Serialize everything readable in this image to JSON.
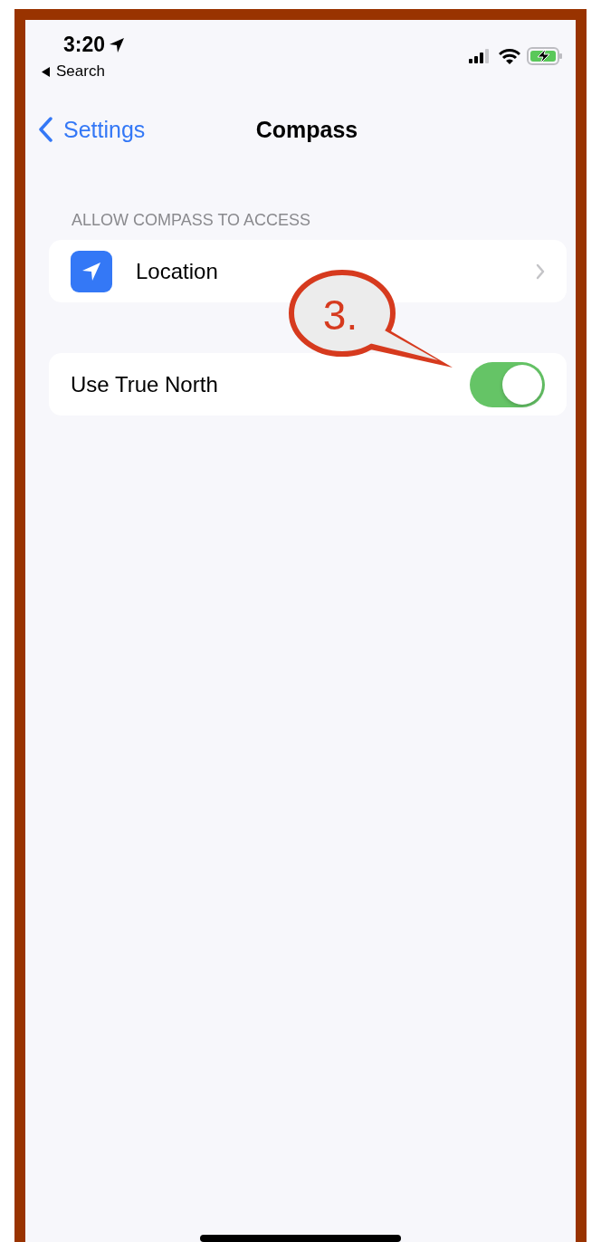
{
  "status_bar": {
    "time": "3:20",
    "back_label": "Search"
  },
  "nav": {
    "back": "Settings",
    "title": "Compass"
  },
  "sections": [
    {
      "header": "ALLOW COMPASS TO ACCESS",
      "rows": [
        {
          "kind": "link",
          "label": "Location"
        }
      ]
    },
    {
      "rows": [
        {
          "kind": "toggle",
          "label": "Use True North",
          "on": true
        }
      ]
    }
  ],
  "annotation": {
    "label": "3."
  }
}
